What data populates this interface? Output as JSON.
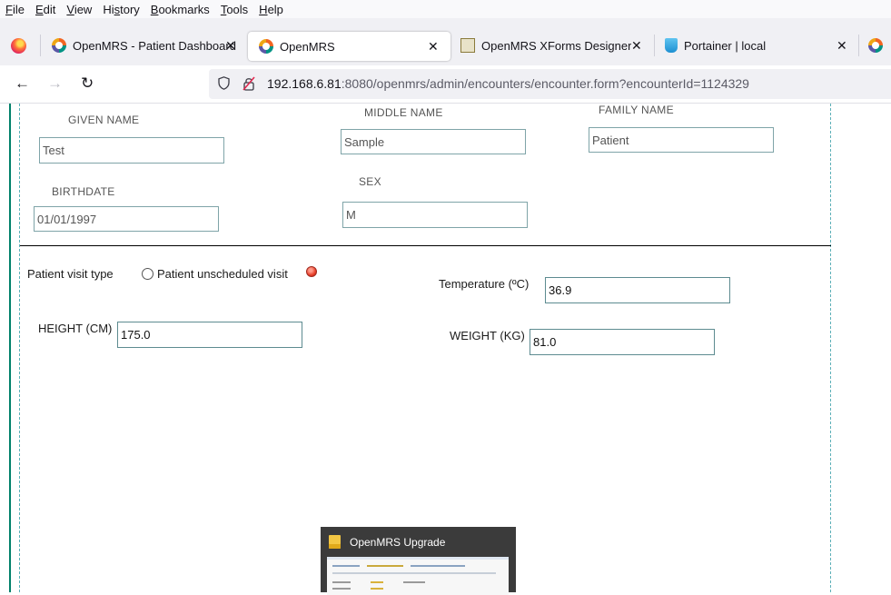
{
  "menu": [
    {
      "underline": "F",
      "rest": "ile"
    },
    {
      "underline": "E",
      "rest": "dit"
    },
    {
      "underline": "V",
      "rest": "iew"
    },
    {
      "pre": "Hi",
      "underline": "s",
      "rest": "tory"
    },
    {
      "underline": "B",
      "rest": "ookmarks"
    },
    {
      "underline": "T",
      "rest": "ools"
    },
    {
      "underline": "H",
      "rest": "elp"
    }
  ],
  "tabs": [
    {
      "title": "OpenMRS - Patient Dashboard",
      "icon": "openmrs-icon",
      "active": false
    },
    {
      "title": "OpenMRS",
      "icon": "openmrs-icon",
      "active": true
    },
    {
      "title": "OpenMRS XForms Designer",
      "icon": "xforms-icon",
      "active": false
    },
    {
      "title": "Portainer | local",
      "icon": "portainer-icon",
      "active": false
    }
  ],
  "nav": {
    "url_host": "192.168.6.81",
    "url_rest": ":8080/openmrs/admin/encounters/encounter.form?encounterId=1124329"
  },
  "form": {
    "given_name_label": "GIVEN NAME",
    "given_name": "Test",
    "middle_name_label": "MIDDLE NAME",
    "middle_name": "Sample",
    "family_name_label": "FAMILY NAME",
    "family_name": "Patient",
    "birthdate_label": "BIRTHDATE",
    "birthdate": "01/01/1997",
    "sex_label": "SEX",
    "sex": "M",
    "visit_type_label": "Patient visit type",
    "visit_option": "Patient unscheduled visit",
    "temperature_label": "Temperature (ºC)",
    "temperature": "36.9",
    "height_label": "HEIGHT (CM)",
    "height": "175.0",
    "weight_label": "WEIGHT (KG)",
    "weight": "81.0"
  },
  "taskbar_preview": {
    "title": "OpenMRS Upgrade"
  }
}
